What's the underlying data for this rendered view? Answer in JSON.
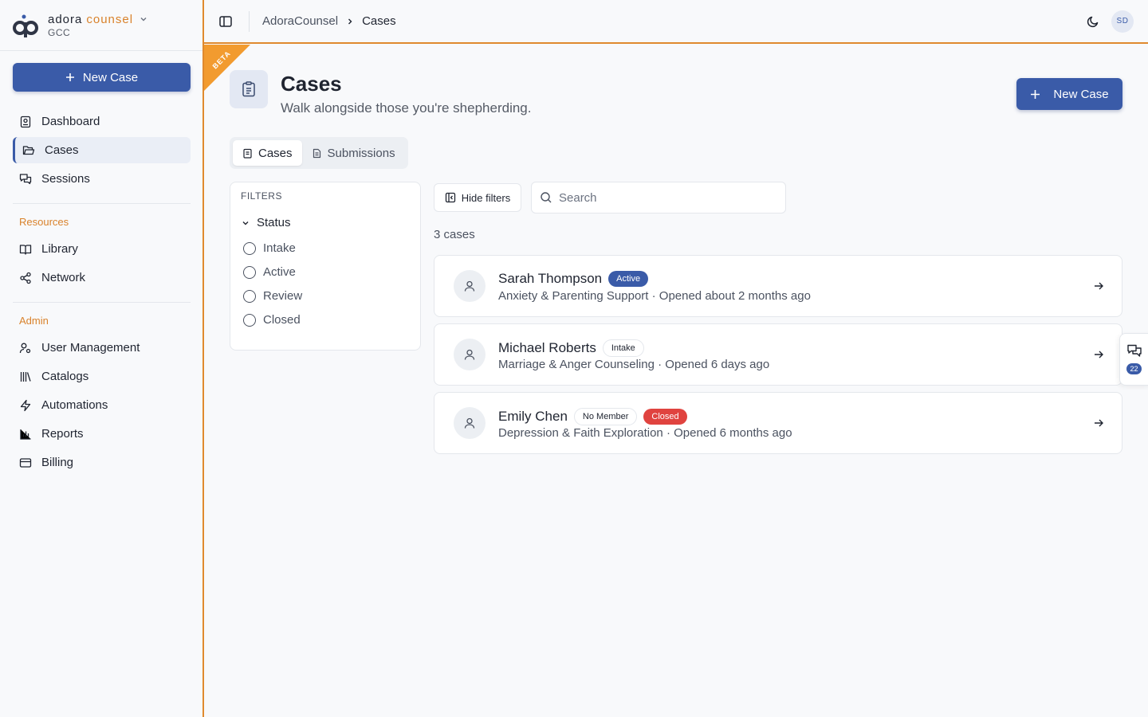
{
  "brand": {
    "name_primary": "adora",
    "name_accent": "counsel",
    "org": "GCC",
    "accent_color": "#d9822b",
    "primary_color": "#3a5ba8"
  },
  "sidebar": {
    "new_case_label": "New Case",
    "main_items": [
      {
        "label": "Dashboard",
        "icon": "dashboard-icon"
      },
      {
        "label": "Cases",
        "icon": "folder-icon",
        "active": true
      },
      {
        "label": "Sessions",
        "icon": "sessions-icon"
      }
    ],
    "resources_heading": "Resources",
    "resources_items": [
      {
        "label": "Library",
        "icon": "book-icon"
      },
      {
        "label": "Network",
        "icon": "share-icon"
      }
    ],
    "admin_heading": "Admin",
    "admin_items": [
      {
        "label": "User Management",
        "icon": "users-icon"
      },
      {
        "label": "Catalogs",
        "icon": "library-icon"
      },
      {
        "label": "Automations",
        "icon": "bolt-icon"
      },
      {
        "label": "Reports",
        "icon": "chart-icon"
      },
      {
        "label": "Billing",
        "icon": "card-icon"
      }
    ]
  },
  "topbar": {
    "breadcrumb_root": "AdoraCounsel",
    "breadcrumb_current": "Cases",
    "avatar_initials": "SD"
  },
  "ribbon": {
    "label": "BETA"
  },
  "page": {
    "title": "Cases",
    "subtitle": "Walk alongside those you're shepherding.",
    "new_case_label": "New Case"
  },
  "tabs": [
    {
      "label": "Cases",
      "active": true
    },
    {
      "label": "Submissions",
      "active": false
    }
  ],
  "filters": {
    "title": "FILTERS",
    "status_heading": "Status",
    "options": [
      "Intake",
      "Active",
      "Review",
      "Closed"
    ]
  },
  "toolbar": {
    "hide_filters_label": "Hide filters",
    "search_placeholder": "Search",
    "count_text": "3 cases"
  },
  "cases": [
    {
      "name": "Sarah Thompson",
      "badges": [
        {
          "text": "Active",
          "style": "active"
        }
      ],
      "meta": "Anxiety & Parenting Support · Opened about 2 months ago"
    },
    {
      "name": "Michael Roberts",
      "badges": [
        {
          "text": "Intake",
          "style": "outline"
        }
      ],
      "meta": "Marriage & Anger Counseling · Opened 6 days ago"
    },
    {
      "name": "Emily Chen",
      "badges": [
        {
          "text": "No Member",
          "style": "outline"
        },
        {
          "text": "Closed",
          "style": "closed"
        }
      ],
      "meta": "Depression & Faith Exploration · Opened 6 months ago"
    }
  ],
  "chat": {
    "count": "22"
  }
}
